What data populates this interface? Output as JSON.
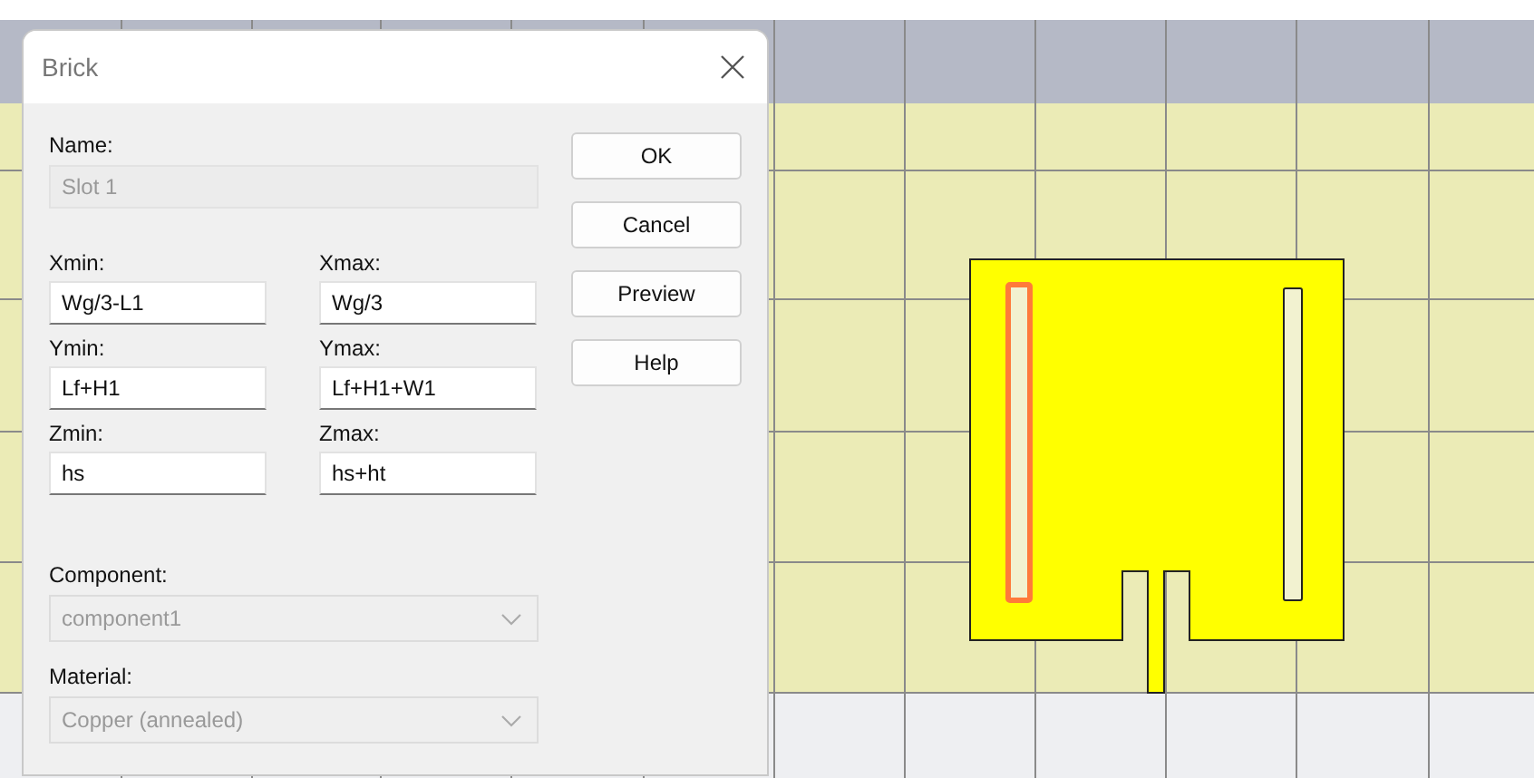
{
  "dialog": {
    "title": "Brick",
    "name": {
      "label": "Name:",
      "value": "Slot 1",
      "disabled": true
    },
    "fields": [
      {
        "label": "Xmin:",
        "value": "Wg/3-L1"
      },
      {
        "label": "Xmax:",
        "value": "Wg/3"
      },
      {
        "label": "Ymin:",
        "value": "Lf+H1"
      },
      {
        "label": "Ymax:",
        "value": "Lf+H1+W1"
      },
      {
        "label": "Zmin:",
        "value": "hs"
      },
      {
        "label": "Zmax:",
        "value": "hs+ht"
      }
    ],
    "buttons": [
      "OK",
      "Cancel",
      "Preview",
      "Help"
    ],
    "component": {
      "label": "Component:",
      "value": "component1",
      "disabled": true
    },
    "material": {
      "label": "Material:",
      "value": "Copper (annealed)",
      "disabled": true
    }
  },
  "canvas": {
    "slots": [
      {
        "selected": true
      },
      {
        "selected": false
      }
    ]
  }
}
